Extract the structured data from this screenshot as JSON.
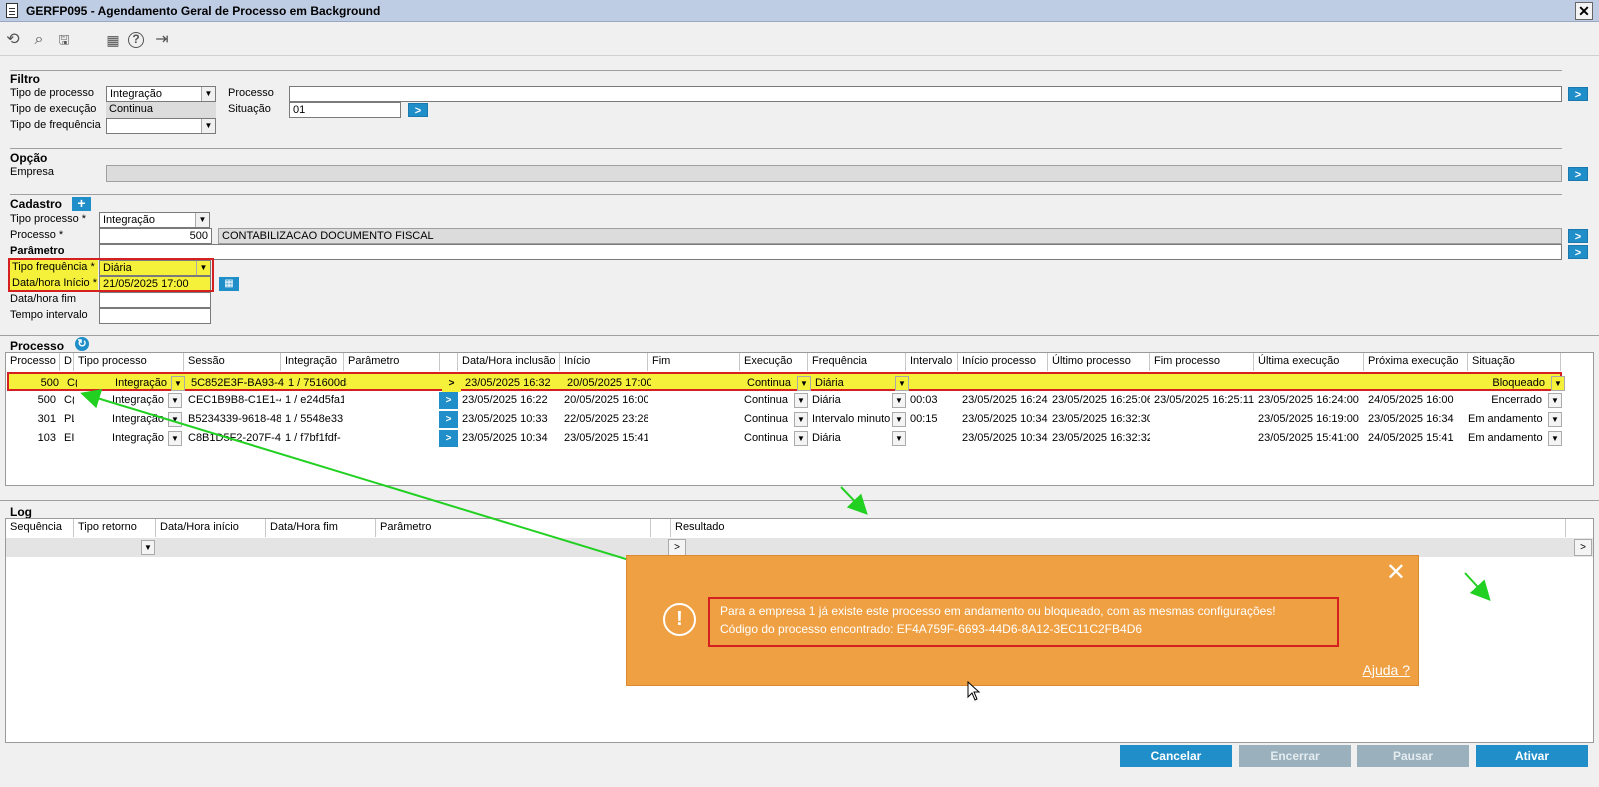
{
  "window": {
    "title": "GERFP095 - Agendamento Geral de Processo em Background",
    "close_label": "✕"
  },
  "toolbar": [
    {
      "icon": "undo-icon",
      "glyph": "⟲"
    },
    {
      "icon": "search-icon",
      "glyph": "⌕"
    },
    {
      "icon": "save-icon",
      "glyph": "🖫"
    },
    {
      "icon": "calendar-icon",
      "glyph": "▦"
    },
    {
      "icon": "help-icon",
      "glyph": "?"
    },
    {
      "icon": "exit-icon",
      "glyph": "⇥"
    }
  ],
  "filtro": {
    "title": "Filtro",
    "tipo_processo_label": "Tipo de processo",
    "tipo_processo_value": "Integração",
    "processo_label": "Processo",
    "processo_value": "",
    "tipo_execucao_label": "Tipo de execução",
    "tipo_execucao_value": "Continua",
    "situacao_label": "Situação",
    "situacao_value": "01",
    "tipo_frequencia_label": "Tipo de frequência",
    "tipo_frequencia_value": "",
    "go": ">"
  },
  "opcao": {
    "title": "Opção",
    "empresa_label": "Empresa",
    "empresa_value": "",
    "go": ">"
  },
  "cadastro": {
    "title": "Cadastro",
    "add": "+",
    "tipo_processo_label": "Tipo processo *",
    "tipo_processo_value": "Integração",
    "processo_label": "Processo *",
    "processo_code": "500",
    "processo_desc": "CONTABILIZACAO DOCUMENTO FISCAL",
    "parametro_label": "Parâmetro",
    "parametro_value": "",
    "tipo_frequencia_label": "Tipo frequência *",
    "tipo_frequencia_value": "Diária",
    "data_inicio_label": "Data/hora Início *",
    "data_inicio_value": "21/05/2025 17:00",
    "data_fim_label": "Data/hora fim",
    "data_fim_value": "",
    "tempo_intervalo_label": "Tempo intervalo",
    "tempo_intervalo_value": "",
    "go": ">"
  },
  "processo": {
    "title": "Processo",
    "refresh": "↻",
    "columns": [
      "Processo",
      "D",
      "Tipo processo",
      "Sessão",
      "Integração",
      "Parâmetro",
      "",
      "Data/Hora inclusão",
      "Início",
      "Fim",
      "Execução",
      "Frequência",
      "Intervalo",
      "Início processo",
      "Último processo",
      "Fim processo",
      "Última execução",
      "Próxima execução",
      "Situação"
    ],
    "rows": [
      {
        "processo": "500",
        "d": "C(",
        "tipo": "Integração",
        "sessao": "5C852E3F-BA93-4F",
        "integracao": "1 / 751600d3",
        "parametro": "",
        "go": ">",
        "inclusao": "23/05/2025 16:32",
        "inicio": "20/05/2025 17:00",
        "fim": "",
        "execucao": "Continua",
        "frequencia": "Diária",
        "intervalo": "",
        "inicio_proc": "",
        "ultimo_proc": "",
        "fim_proc": "",
        "ultima_exec": "",
        "proxima_exec": "",
        "situacao": "Bloqueado"
      },
      {
        "processo": "500",
        "d": "C(",
        "tipo": "Integração",
        "sessao": "CEC1B9B8-C1E1-4/",
        "integracao": "1 / e24d5fa1",
        "parametro": "",
        "go": ">",
        "inclusao": "23/05/2025 16:22",
        "inicio": "20/05/2025 16:00",
        "fim": "",
        "execucao": "Continua",
        "frequencia": "Diária",
        "intervalo": "00:03",
        "inicio_proc": "23/05/2025 16:24",
        "ultimo_proc": "23/05/2025 16:25:06",
        "fim_proc": "23/05/2025 16:25:11",
        "ultima_exec": "23/05/2025 16:24:00",
        "proxima_exec": "24/05/2025 16:00",
        "situacao": "Encerrado"
      },
      {
        "processo": "301",
        "d": "PL",
        "tipo": "Integração",
        "sessao": "B5234339-9618-48",
        "integracao": "1 / 5548e33",
        "parametro": "",
        "go": ">",
        "inclusao": "23/05/2025 10:33",
        "inicio": "22/05/2025 23:28",
        "fim": "",
        "execucao": "Continua",
        "frequencia": "Intervalo minuto",
        "intervalo": "00:15",
        "inicio_proc": "23/05/2025 10:34",
        "ultimo_proc": "23/05/2025 16:32:30",
        "fim_proc": "",
        "ultima_exec": "23/05/2025 16:19:00",
        "proxima_exec": "23/05/2025 16:34",
        "situacao": "Em andamento"
      },
      {
        "processo": "103",
        "d": "EI",
        "tipo": "Integração",
        "sessao": "C8B1D5F2-207F-42",
        "integracao": "1 / f7bf1fdf-",
        "parametro": "",
        "go": ">",
        "inclusao": "23/05/2025 10:34",
        "inicio": "23/05/2025 15:41",
        "fim": "",
        "execucao": "Continua",
        "frequencia": "Diária",
        "intervalo": "",
        "inicio_proc": "23/05/2025 10:34",
        "ultimo_proc": "23/05/2025 16:32:32",
        "fim_proc": "",
        "ultima_exec": "23/05/2025 15:41:00",
        "proxima_exec": "24/05/2025 15:41",
        "situacao": "Em andamento"
      }
    ]
  },
  "log": {
    "title": "Log",
    "columns": [
      "Sequência",
      "Tipo retorno",
      "Data/Hora início",
      "Data/Hora fim",
      "Parâmetro",
      "",
      "Resultado"
    ],
    "go": ">"
  },
  "toast": {
    "line1": "Para a empresa 1 já existe este processo em andamento ou bloqueado, com as mesmas configurações!",
    "line2": "Código do processo encontrado: EF4A759F-6693-44D6-8A12-3EC11C2FB4D6",
    "close": "✕",
    "help": "Ajuda ?",
    "icon": "!"
  },
  "buttons": {
    "cancelar": "Cancelar",
    "encerrar": "Encerrar",
    "pausar": "Pausar",
    "ativar": "Ativar"
  },
  "colors": {
    "accent": "#1f8ec9",
    "toast": "#efa043",
    "highlight": "#f5f03a",
    "alert": "#d42020",
    "arrow": "#22d022"
  }
}
